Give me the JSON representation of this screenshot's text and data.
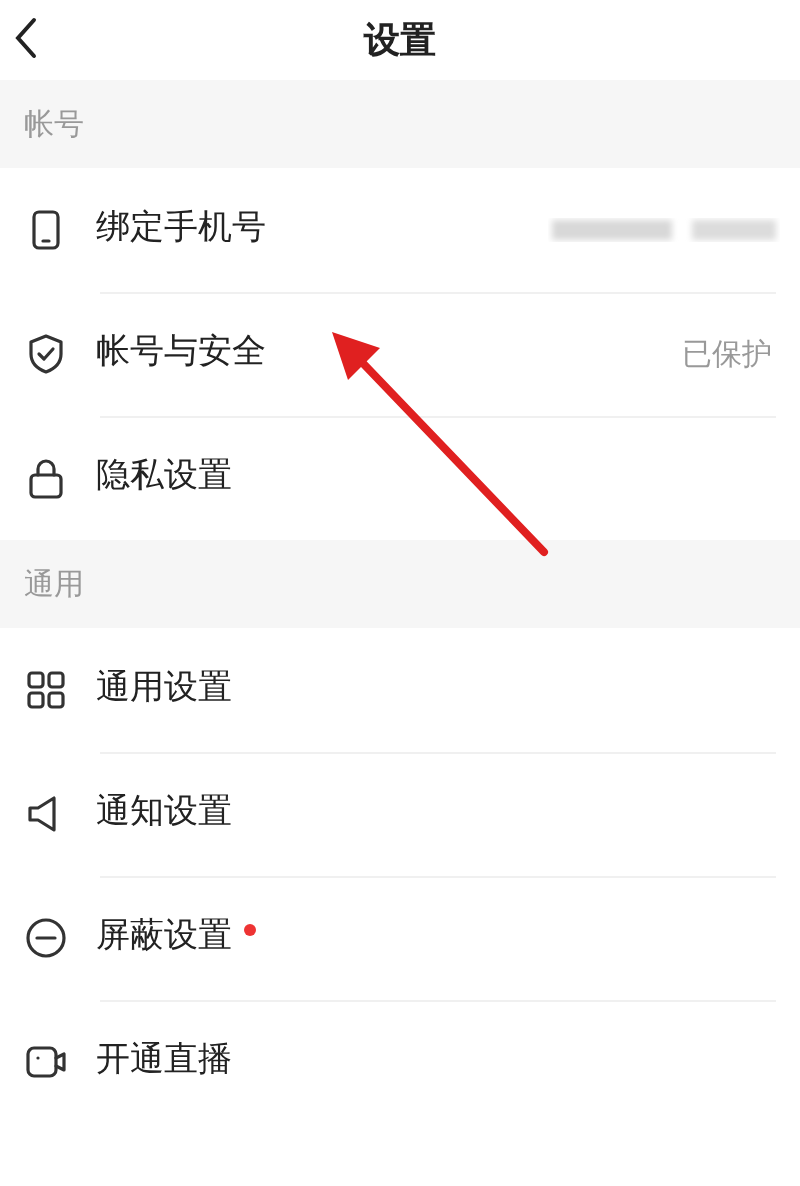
{
  "header": {
    "title": "设置"
  },
  "sections": [
    {
      "title": "帐号",
      "items": [
        {
          "label": "绑定手机号",
          "blurred_value": true,
          "dot": false
        },
        {
          "label": "帐号与安全",
          "value": "已保护",
          "blurred_value": false,
          "dot": false
        },
        {
          "label": "隐私设置",
          "blurred_value": false,
          "dot": false
        }
      ]
    },
    {
      "title": "通用",
      "items": [
        {
          "label": "通用设置",
          "blurred_value": false,
          "dot": false
        },
        {
          "label": "通知设置",
          "blurred_value": false,
          "dot": false
        },
        {
          "label": "屏蔽设置",
          "blurred_value": false,
          "dot": true
        },
        {
          "label": "开通直播",
          "blurred_value": false,
          "dot": false
        }
      ]
    }
  ],
  "annotation": {
    "kind": "arrow"
  }
}
